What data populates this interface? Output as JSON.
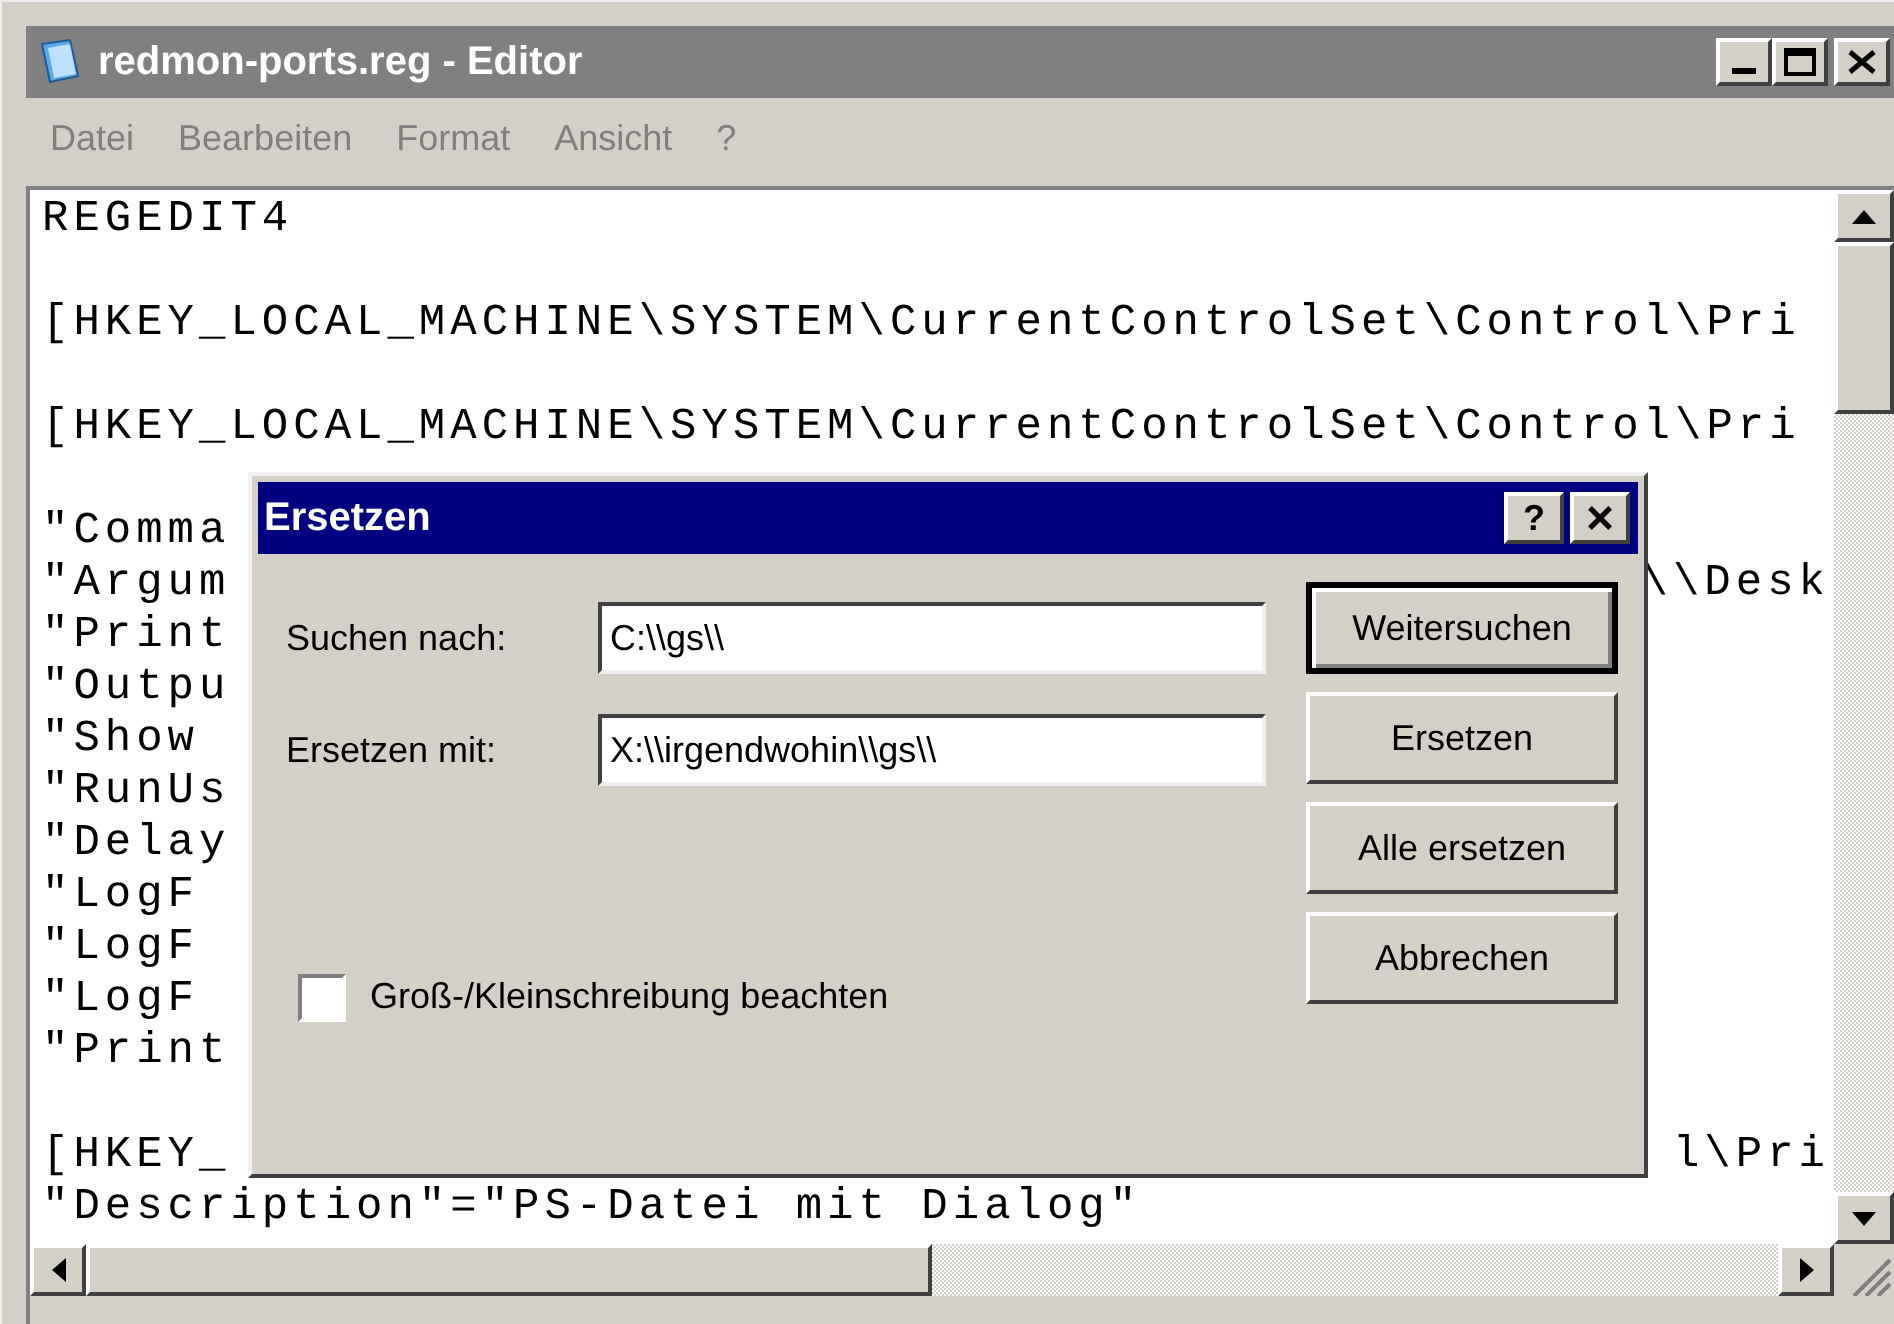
{
  "window": {
    "title": "redmon-ports.reg - Editor"
  },
  "menu": [
    "Datei",
    "Bearbeiten",
    "Format",
    "Ansicht",
    "?"
  ],
  "editor": {
    "lines": [
      {
        "text": "REGEDIT4"
      },
      {
        "text": "[HKEY_LOCAL_MACHINE\\SYSTEM\\CurrentControlSet\\Control\\Pri",
        "blank_before": true
      },
      {
        "text": "[HKEY_LOCAL_MACHINE\\SYSTEM\\CurrentControlSet\\Control\\Pri",
        "blank_before": true
      },
      {
        "text": "\"Comma",
        "blank_before": true
      },
      {
        "text": "\"Argum",
        "tail": "\\\\Desk"
      },
      {
        "text": "\"Print"
      },
      {
        "text": "\"Outpu"
      },
      {
        "text": "\"Show"
      },
      {
        "text": "\"RunUs"
      },
      {
        "text": "\"Delay"
      },
      {
        "text": "\"LogF"
      },
      {
        "text": "\"LogF"
      },
      {
        "text": "\"LogF"
      },
      {
        "text": "\"Print"
      },
      {
        "text": "[HKEY_",
        "tail": "l\\Pri",
        "blank_before": true
      },
      {
        "text": "\"Description\"=\"PS-Datei mit Dialog\""
      }
    ]
  },
  "dialog": {
    "title": "Ersetzen",
    "help": "?",
    "close": "×",
    "fields": [
      {
        "label": "Suchen nach:",
        "value": "C:\\\\gs\\\\"
      },
      {
        "label": "Ersetzen mit:",
        "value": "X:\\\\irgendwohin\\\\gs\\\\"
      }
    ],
    "checkbox": {
      "label": "Groß-/Kleinschreibung beachten",
      "checked": false
    },
    "buttons": [
      {
        "label": "Weitersuchen",
        "default": true
      },
      {
        "label": "Ersetzen",
        "default": false
      },
      {
        "label": "Alle ersetzen",
        "default": false
      },
      {
        "label": "Abbrechen",
        "default": false
      }
    ]
  }
}
